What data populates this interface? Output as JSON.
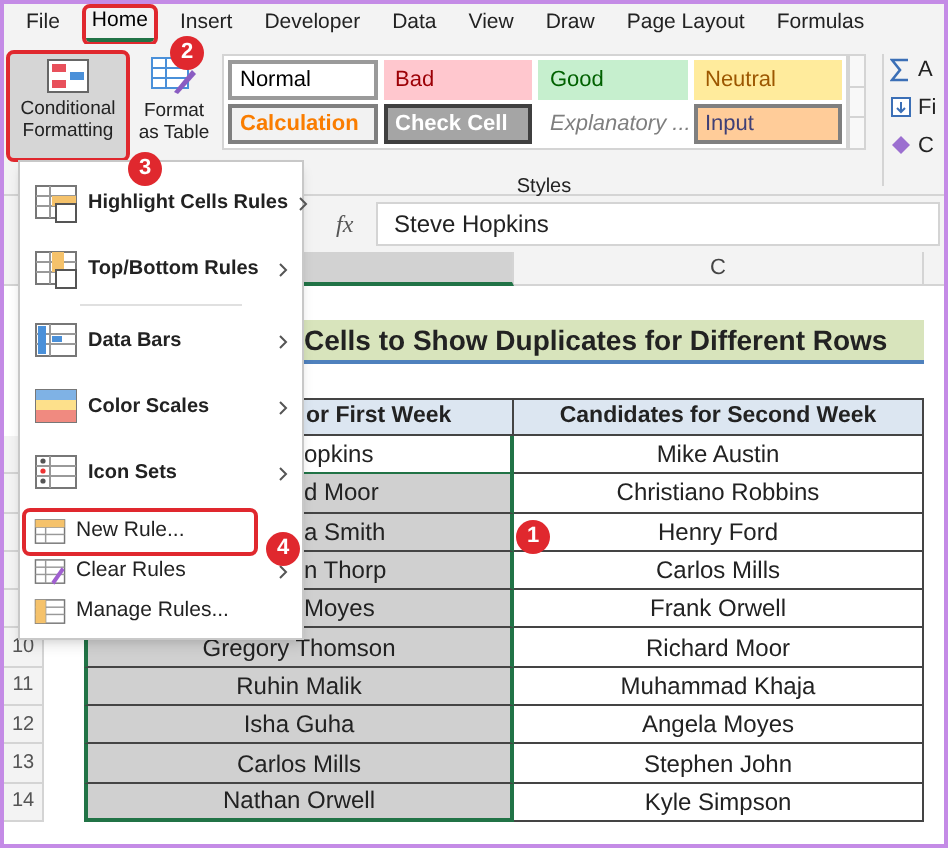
{
  "ribbon_tabs": [
    {
      "label": "File",
      "selected": false,
      "outlined": false
    },
    {
      "label": "Home",
      "selected": true,
      "outlined": true
    },
    {
      "label": "Insert",
      "selected": false,
      "outlined": false
    },
    {
      "label": "Developer",
      "selected": false,
      "outlined": false
    },
    {
      "label": "Data",
      "selected": false,
      "outlined": false
    },
    {
      "label": "View",
      "selected": false,
      "outlined": false
    },
    {
      "label": "Draw",
      "selected": false,
      "outlined": false
    },
    {
      "label": "Page Layout",
      "selected": false,
      "outlined": false
    },
    {
      "label": "Formulas",
      "selected": false,
      "outlined": false
    }
  ],
  "ribbon": {
    "conditional_formatting": {
      "label": "Conditional Formatting",
      "outlined": true
    },
    "format_as_table": {
      "label": "Format as Table"
    },
    "styles": [
      {
        "label": "Normal",
        "kind": "normal"
      },
      {
        "label": "Bad",
        "kind": "bad"
      },
      {
        "label": "Good",
        "kind": "good"
      },
      {
        "label": "Neutral",
        "kind": "neutral"
      },
      {
        "label": "Calculation",
        "kind": "calculation"
      },
      {
        "label": "Check Cell",
        "kind": "check"
      },
      {
        "label": "Explanatory ...",
        "kind": "explanatory"
      },
      {
        "label": "Input",
        "kind": "input"
      }
    ],
    "styles_group_label": "Styles",
    "editing_items": [
      "A",
      "Fi",
      "C"
    ]
  },
  "formula_bar": {
    "fx": "fx",
    "value": "Steve Hopkins"
  },
  "column_headers": [
    {
      "selected": true
    },
    {
      "label": "C",
      "selected": false
    }
  ],
  "sheet": {
    "title": "Cells to Show Duplicates for Different Rows",
    "header": [
      "or First Week",
      "Candidates for Second Week"
    ],
    "rows": [
      {
        "first": {
          "text": "opkins",
          "kind": "partial"
        },
        "active": true,
        "second": "Mike Austin"
      },
      {
        "first": {
          "text": "d Moor",
          "kind": "partial"
        },
        "active": false,
        "second": "Christiano Robbins"
      },
      {
        "first": {
          "text": "a Smith",
          "kind": "partial"
        },
        "active": false,
        "second": "Henry Ford"
      },
      {
        "first": {
          "text": "n Thorp",
          "kind": "partial"
        },
        "active": false,
        "second": "Carlos Mills"
      },
      {
        "first": {
          "text": "Moyes",
          "kind": "partial"
        },
        "active": false,
        "second": "Frank Orwell"
      },
      {
        "row_number": "10",
        "first": {
          "text": "Gregory Thomson",
          "kind": "whole"
        },
        "active": false,
        "second": "Richard Moor"
      },
      {
        "row_number": "11",
        "first": {
          "text": "Ruhin Malik",
          "kind": "whole"
        },
        "active": false,
        "second": "Muhammad Khaja"
      },
      {
        "row_number": "12",
        "first": {
          "text": "Isha Guha",
          "kind": "whole"
        },
        "active": false,
        "second": "Angela Moyes"
      },
      {
        "row_number": "13",
        "first": {
          "text": "Carlos Mills",
          "kind": "whole"
        },
        "active": false,
        "second": "Stephen John"
      },
      {
        "row_number": "14",
        "first": {
          "text": "Nathan Orwell",
          "kind": "whole"
        },
        "active": false,
        "second": "Kyle Simpson"
      }
    ]
  },
  "menu": {
    "groups": [
      [
        {
          "label": "Highlight Cells Rules",
          "submenu": true,
          "outlined": false
        },
        {
          "label": "Top/Bottom Rules",
          "submenu": true,
          "outlined": false
        }
      ],
      [
        {
          "label": "Data Bars",
          "submenu": true,
          "outlined": false
        },
        {
          "label": "Color Scales",
          "submenu": true,
          "outlined": false
        },
        {
          "label": "Icon Sets",
          "submenu": true,
          "outlined": false
        }
      ],
      [
        {
          "label": "New Rule...",
          "submenu": false,
          "outlined": true
        },
        {
          "label": "Clear Rules",
          "submenu": true,
          "outlined": false
        },
        {
          "label": "Manage Rules...",
          "submenu": false,
          "outlined": false
        }
      ]
    ]
  },
  "callouts": [
    {
      "text": "1",
      "kind": "cell"
    },
    {
      "text": "2",
      "kind": "tab"
    },
    {
      "text": "3",
      "kind": "button"
    },
    {
      "text": "4",
      "kind": "menu"
    }
  ]
}
